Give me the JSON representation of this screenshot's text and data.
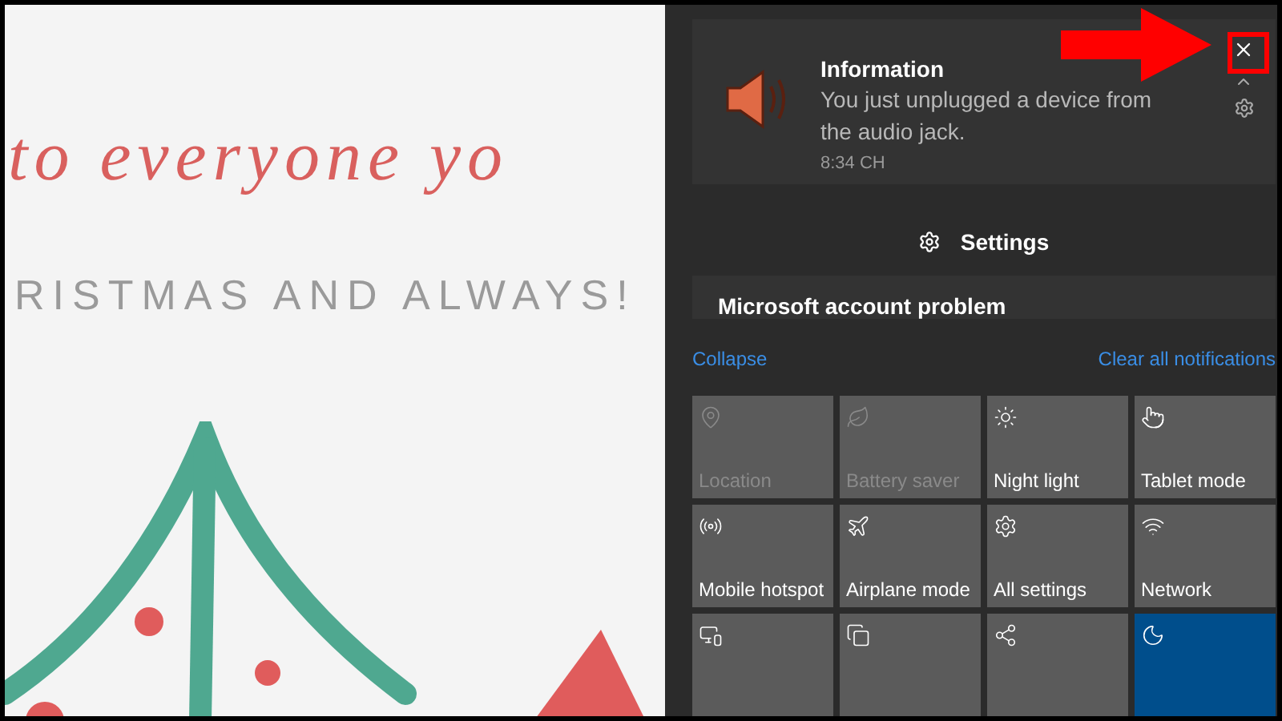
{
  "greeting_card": {
    "script_line": "to everyone yo",
    "caption": "RISTMAS AND ALWAYS!"
  },
  "notification": {
    "title": "Information",
    "message": "You just unplugged a device from the audio jack.",
    "time": "8:34 CH"
  },
  "settings_button": {
    "label": "Settings"
  },
  "notification_2": {
    "title": "Microsoft account problem"
  },
  "collapse_link": "Collapse",
  "clear_all_link": "Clear all notifications",
  "quick_actions": [
    {
      "kind": "location",
      "label": "Location",
      "disabled": true,
      "on": false
    },
    {
      "kind": "battery",
      "label": "Battery saver",
      "disabled": true,
      "on": false
    },
    {
      "kind": "night",
      "label": "Night light",
      "disabled": false,
      "on": false
    },
    {
      "kind": "tablet",
      "label": "Tablet mode",
      "disabled": false,
      "on": false
    },
    {
      "kind": "hotspot",
      "label": "Mobile hotspot",
      "disabled": false,
      "on": false
    },
    {
      "kind": "airplane",
      "label": "Airplane mode",
      "disabled": false,
      "on": false
    },
    {
      "kind": "settings",
      "label": "All settings",
      "disabled": false,
      "on": false
    },
    {
      "kind": "network",
      "label": "Network",
      "disabled": false,
      "on": false
    },
    {
      "kind": "connect",
      "disabled": false,
      "on": false
    },
    {
      "kind": "project",
      "disabled": false,
      "on": false
    },
    {
      "kind": "share",
      "disabled": false,
      "on": false
    },
    {
      "kind": "focus",
      "disabled": false,
      "on": true
    }
  ]
}
